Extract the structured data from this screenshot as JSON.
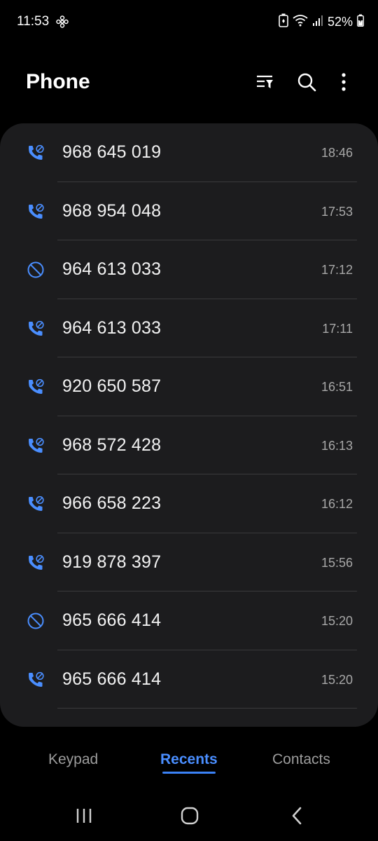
{
  "status_bar": {
    "time": "11:53",
    "battery_percent": "52%"
  },
  "header": {
    "title": "Phone",
    "icons": [
      "filter-icon",
      "search-icon",
      "more-vert-icon"
    ]
  },
  "calls": [
    {
      "number": "968 645 019",
      "time": "18:46",
      "type": "outgoing"
    },
    {
      "number": "968 954 048",
      "time": "17:53",
      "type": "outgoing"
    },
    {
      "number": "964 613 033",
      "time": "17:12",
      "type": "blocked"
    },
    {
      "number": "964 613 033",
      "time": "17:11",
      "type": "outgoing"
    },
    {
      "number": "920 650 587",
      "time": "16:51",
      "type": "outgoing"
    },
    {
      "number": "968 572 428",
      "time": "16:13",
      "type": "outgoing"
    },
    {
      "number": "966 658 223",
      "time": "16:12",
      "type": "outgoing"
    },
    {
      "number": "919 878 397",
      "time": "15:56",
      "type": "outgoing"
    },
    {
      "number": "965 666 414",
      "time": "15:20",
      "type": "blocked"
    },
    {
      "number": "965 666 414",
      "time": "15:20",
      "type": "outgoing"
    }
  ],
  "tabs": [
    {
      "label": "Keypad",
      "active": false
    },
    {
      "label": "Recents",
      "active": true
    },
    {
      "label": "Contacts",
      "active": false
    }
  ],
  "colors": {
    "accent": "#4a8eff",
    "call_icon": "#4a8eff",
    "card_bg": "#1c1c1e",
    "background": "#000000",
    "secondary_text": "#a8a8a8"
  }
}
